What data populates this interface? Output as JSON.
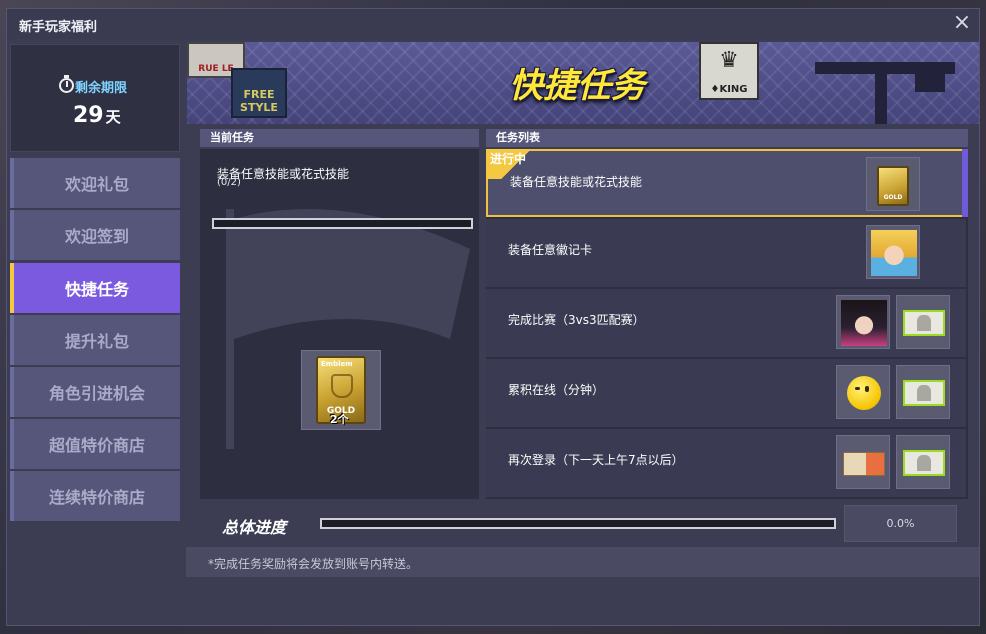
{
  "window": {
    "title": "新手玩家福利",
    "close_icon": "×"
  },
  "remain": {
    "label": "剩余期限",
    "days": "29",
    "unit": "天"
  },
  "nav": {
    "items": [
      {
        "label": "欢迎礼包",
        "active": false
      },
      {
        "label": "欢迎签到",
        "active": false
      },
      {
        "label": "快捷任务",
        "active": true
      },
      {
        "label": "提升礼包",
        "active": false
      },
      {
        "label": "角色引进机会",
        "active": false
      },
      {
        "label": "超值特价商店",
        "active": false
      },
      {
        "label": "连续特价商店",
        "active": false
      }
    ]
  },
  "banner": {
    "title": "快捷任务",
    "sign_king": "♦KING",
    "sign_rue": "RUE LE",
    "sign_free": "FREE STYLE"
  },
  "current_task": {
    "header": "当前任务",
    "title": "装备任意技能或花式技能",
    "count": "(0/2)",
    "progress": 0,
    "reward": {
      "card_top": "Emblem",
      "card_bottom": "GOLD",
      "count": "2个"
    }
  },
  "task_list": {
    "header": "任务列表",
    "rows": [
      {
        "title": "装备任意技能或花式技能",
        "status": "进行中",
        "icons": [
          "gold-card-icon"
        ]
      },
      {
        "title": "装备任意徽记卡",
        "icons": [
          "character-blonde-icon"
        ]
      },
      {
        "title": "完成比赛（3vs3匹配赛）",
        "icons": [
          "character-dark-icon",
          "ticket-icon"
        ]
      },
      {
        "title": "累积在线（分钟）",
        "icons": [
          "smiley-icon",
          "ticket-icon"
        ]
      },
      {
        "title": "再次登录（下一天上午7点以后）",
        "icons": [
          "login-card-icon",
          "ticket-icon"
        ]
      }
    ],
    "mini_gold_label": "GOLD"
  },
  "total": {
    "label": "总体进度",
    "progress": 0,
    "percent": "0.0%"
  },
  "footnote": "*完成任务奖励将会发放到账号内转送。",
  "colors": {
    "accent": "#7c5ae0",
    "highlight": "#f0c040",
    "banner_title": "#ffe838",
    "remain_label": "#7fd3ff"
  }
}
